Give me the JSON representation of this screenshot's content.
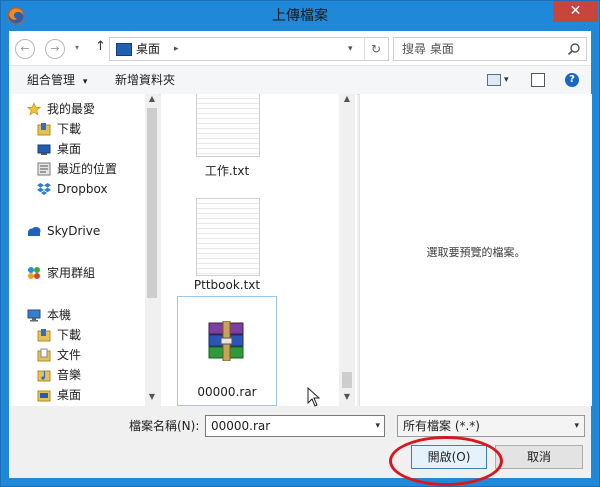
{
  "window": {
    "title": "上傳檔案",
    "close_glyph": "✕"
  },
  "address_bar": {
    "back_glyph": "←",
    "forward_glyph": "→",
    "up_glyph": "↑",
    "path": "桌面",
    "path_separator": "▸",
    "dropdown_glyph": "▾",
    "refresh_glyph": "↻",
    "search_placeholder": "搜尋 桌面"
  },
  "toolbar": {
    "organize": "組合管理",
    "organize_caret": "▾",
    "new_folder": "新增資料夾",
    "view_caret": "▾",
    "help_glyph": "?"
  },
  "nav": {
    "items": [
      {
        "label": "我的最愛",
        "icon": "star-icon"
      },
      {
        "label": "下載",
        "icon": "downloads-folder-icon"
      },
      {
        "label": "桌面",
        "icon": "desktop-icon"
      },
      {
        "label": "最近的位置",
        "icon": "recent-places-icon"
      },
      {
        "label": "Dropbox",
        "icon": "dropbox-icon"
      },
      {
        "label": "SkyDrive",
        "icon": "skydrive-icon"
      },
      {
        "label": "家用群組",
        "icon": "homegroup-icon"
      },
      {
        "label": "本機",
        "icon": "computer-icon"
      },
      {
        "label": "下載",
        "icon": "downloads-folder-icon"
      },
      {
        "label": "文件",
        "icon": "documents-folder-icon"
      },
      {
        "label": "音樂",
        "icon": "music-folder-icon"
      },
      {
        "label": "桌面",
        "icon": "desktop-icon"
      }
    ]
  },
  "files": [
    {
      "name": "工作.txt",
      "icon": "text-file-icon"
    },
    {
      "name": "Pttbook.txt",
      "icon": "text-file-icon"
    },
    {
      "name": "00000.rar",
      "icon": "winrar-archive-icon"
    }
  ],
  "preview": {
    "message": "選取要預覽的檔案。"
  },
  "footer": {
    "filename_label": "檔案名稱(N):",
    "filename_value": "00000.rar",
    "filter_value": "所有檔案 (*.*)",
    "open_button": "開啟(O)",
    "cancel_button": "取消"
  },
  "colors": {
    "titlebar": "#1f88d8",
    "close": "#c7453b",
    "highlight_circle": "#d7191f"
  }
}
